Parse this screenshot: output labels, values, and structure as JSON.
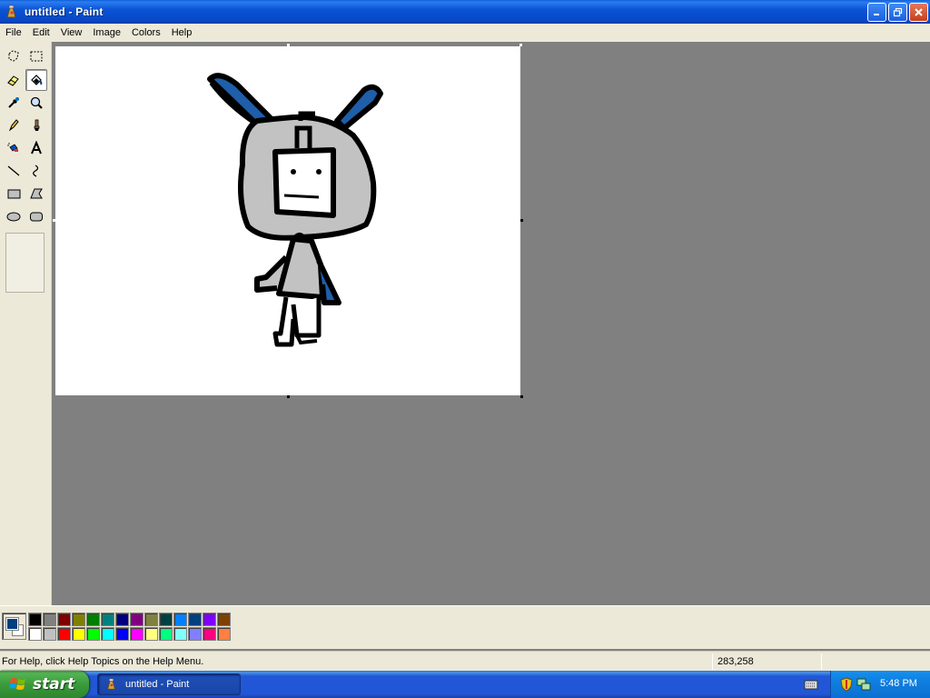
{
  "window": {
    "title": "untitled - Paint"
  },
  "menu": {
    "items": [
      "File",
      "Edit",
      "View",
      "Image",
      "Colors",
      "Help"
    ]
  },
  "tools": [
    "free-form-select",
    "rectangle-select",
    "eraser",
    "fill-with-color",
    "pick-color",
    "magnifier",
    "pencil",
    "brush",
    "airbrush",
    "text",
    "line",
    "curve",
    "rectangle",
    "polygon",
    "ellipse",
    "rounded-rectangle"
  ],
  "selected_tool": "fill-with-color",
  "colors": {
    "foreground": "#003f7f",
    "background": "#ffffff",
    "palette_top": [
      "#000000",
      "#808080",
      "#800000",
      "#808000",
      "#008000",
      "#008080",
      "#000080",
      "#800080",
      "#808040",
      "#004040",
      "#0080ff",
      "#004080",
      "#8000ff",
      "#804000"
    ],
    "palette_bottom": [
      "#ffffff",
      "#c0c0c0",
      "#ff0000",
      "#ffff00",
      "#00ff00",
      "#00ffff",
      "#0000ff",
      "#ff00ff",
      "#ffff80",
      "#00ff80",
      "#80ffff",
      "#8080ff",
      "#ff0080",
      "#ff8040"
    ]
  },
  "status": {
    "help": "For Help, click Help Topics on the Help Menu.",
    "coords": "283,258"
  },
  "taskbar": {
    "start_label": "start",
    "task_label": "untitled - Paint",
    "clock": "5:48 PM"
  }
}
